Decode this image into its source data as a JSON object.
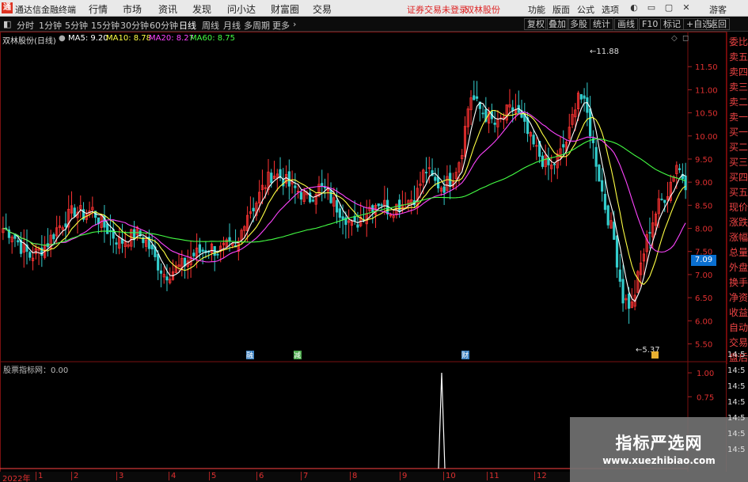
{
  "app": {
    "logo": "通",
    "title": "通达信金融终端",
    "menu": [
      "行情",
      "市场",
      "资讯",
      "发现",
      "问小达",
      "财富圈",
      "交易"
    ],
    "login_status": "证券交易未登录",
    "stock_title": "双林股份",
    "right_menu": [
      "功能",
      "版面",
      "公式",
      "选项"
    ],
    "guest": "游客"
  },
  "toolbar": {
    "back": "◧",
    "periods": [
      "分时",
      "1分钟",
      "5分钟",
      "15分钟",
      "30分钟",
      "60分钟",
      "日线",
      "周线",
      "月线",
      "多周期",
      "更多"
    ],
    "active_period": "日线",
    "right_buttons": [
      "复权",
      "叠加",
      "多股",
      "统计",
      "画线",
      "F10",
      "标记",
      "+自选",
      "返回"
    ]
  },
  "legend": {
    "stock": "双林股份(日线)",
    "ma": [
      {
        "label": "MA5: 9.20",
        "color": "#ffffff"
      },
      {
        "label": "MA10: 8.78",
        "color": "#ffff44"
      },
      {
        "label": "MA20: 8.27",
        "color": "#ff44ff"
      },
      {
        "label": "MA60: 8.75",
        "color": "#44ff44"
      }
    ]
  },
  "price_axis": [
    "11.50",
    "11.00",
    "10.50",
    "10.00",
    "9.50",
    "9.00",
    "8.50",
    "8.00",
    "7.50",
    "7.00",
    "6.50",
    "6.00",
    "5.50"
  ],
  "current_price": "7.09",
  "annotations": {
    "high": "11.88",
    "low": "5.37"
  },
  "markers": [
    "融",
    "减",
    "财"
  ],
  "right_panel": [
    "委比",
    "卖五",
    "卖四",
    "卖三",
    "卖二",
    "卖一",
    "买一",
    "买二",
    "买三",
    "买四",
    "买五",
    "现价",
    "涨跌",
    "涨幅",
    "总量",
    "外盘",
    "换手",
    "净资",
    "收益",
    "自动",
    "交易",
    "盘后"
  ],
  "right_times": [
    "14:5",
    "14:5",
    "14:5",
    "14:5",
    "14:5",
    "14:5",
    "14:5"
  ],
  "indicator": {
    "title": "股票指标网：0.00",
    "axis": [
      "1.00",
      "0.75"
    ]
  },
  "date_axis": {
    "year": "2022年",
    "months": [
      "1",
      "2",
      "3",
      "4",
      "5",
      "6",
      "7",
      "8",
      "9",
      "10",
      "11",
      "12"
    ]
  },
  "watermark": {
    "name": "指标严选网",
    "url": "www.xuezhibiao.com"
  },
  "chart_data": {
    "type": "candlestick",
    "ylim": [
      5.2,
      12.0
    ],
    "series": [
      {
        "name": "MA5",
        "color": "#ffffff"
      },
      {
        "name": "MA10",
        "color": "#ffff44"
      },
      {
        "name": "MA20",
        "color": "#ff44ff"
      },
      {
        "name": "MA60",
        "color": "#44ff44"
      }
    ],
    "close_path": [
      8.0,
      7.9,
      7.6,
      7.4,
      7.5,
      7.7,
      8.0,
      8.2,
      8.4,
      8.3,
      8.4,
      8.1,
      7.9,
      7.7,
      7.8,
      7.9,
      7.7,
      7.3,
      7.0,
      7.1,
      7.2,
      7.4,
      7.5,
      7.6,
      7.5,
      7.6,
      7.5,
      8.3,
      8.5,
      8.9,
      9.2,
      9.1,
      8.9,
      8.8,
      8.6,
      8.9,
      8.8,
      8.5,
      8.3,
      8.0,
      8.3,
      8.5,
      8.6,
      8.4,
      8.5,
      8.6,
      8.7,
      9.3,
      9.0,
      8.9,
      9.1,
      9.6,
      10.9,
      10.6,
      10.4,
      10.2,
      10.5,
      10.6,
      10.2,
      9.8,
      9.5,
      9.3,
      9.6,
      10.0,
      11.0,
      10.5,
      9.5,
      8.5,
      7.8,
      6.5,
      6.3,
      7.2,
      8.0,
      8.5,
      8.8,
      9.4,
      9.0
    ],
    "indicator_spike": {
      "month": "10",
      "value": 1.0
    }
  }
}
